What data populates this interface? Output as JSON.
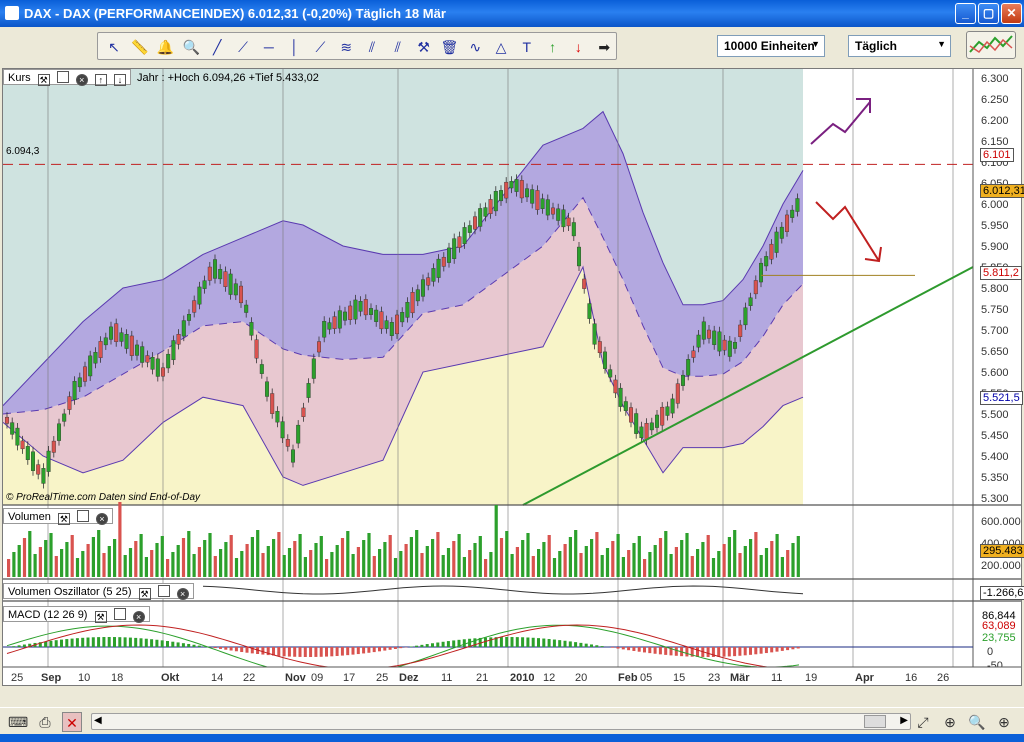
{
  "window": {
    "title": "DAX - DAX (PERFORMANCEINDEX)      6.012,31 (-0,20%)      Täglich   18 Mär"
  },
  "toolbar": {
    "icons": [
      "cursor-icon",
      "ruler-icon",
      "alarm-icon",
      "zoom-icon",
      "line-icon",
      "ray-icon",
      "horizontal-line-icon",
      "vertical-line-icon",
      "fan-icon",
      "fibonacci-icon",
      "channel-icon",
      "parallel-icon",
      "tools-icon",
      "trash-icon",
      "pattern-icon",
      "triangle-icon",
      "text-icon",
      "buy-arrow-icon",
      "sell-arrow-icon",
      "next-arrow-icon"
    ],
    "units_select": "10000 Einheiten",
    "period_select": "Täglich"
  },
  "price_panel": {
    "label": "Kurs",
    "stats": "Jahr : +Hoch 6.094,26 +Tief 5.433,02",
    "high_line_label": "6.094,3",
    "copyright": "© ProRealTime.com  Daten sind End-of-Day",
    "badges": {
      "resistance": "6.101",
      "last": "6.012,31",
      "support": "5.811,2",
      "lower": "5.521,5"
    },
    "axis_ticks": [
      "6.300",
      "6.250",
      "6.200",
      "6.150",
      "6.100",
      "6.050",
      "6.000",
      "5.950",
      "5.900",
      "5.850",
      "5.800",
      "5.750",
      "5.700",
      "5.650",
      "5.600",
      "5.550",
      "5.500",
      "5.450",
      "5.400",
      "5.350",
      "5.300"
    ]
  },
  "volume_panel": {
    "label": "Volumen",
    "axis_ticks": [
      "600.000",
      "400.000",
      "200.000"
    ],
    "badge": "295.483"
  },
  "oscillator_panel": {
    "label": "Volumen Oszillator (5 25)",
    "badge": "-1.266,6"
  },
  "macd_panel": {
    "label": "MACD (12 26 9)",
    "badges": [
      "86,844",
      "63,089",
      "23,755"
    ],
    "axis_ticks": [
      "50",
      "0",
      "-50",
      "-100"
    ]
  },
  "x_axis": {
    "labels": [
      "25",
      "Sep",
      "10",
      "18",
      "Okt",
      "14",
      "22",
      "Nov",
      "09",
      "17",
      "25",
      "Dez",
      "11",
      "21",
      "2010",
      "12",
      "20",
      "Feb",
      "05",
      "15",
      "23",
      "Mär",
      "11",
      "19",
      "Apr",
      "16",
      "26"
    ]
  },
  "colors": {
    "upper_band": "#b3a8e0",
    "lower_band": "#e8c8d0",
    "below_band": "#f8f4c8",
    "bull_candle": "#2ca02c",
    "bear_candle": "#d9534f",
    "trendline": "#2e9a2e",
    "title_bar": "#0a5fd8"
  },
  "statusbar": {
    "icons": [
      "keyboard-icon",
      "print-icon",
      "disconnect-icon",
      "scroll-left-icon",
      "scroll-right-icon",
      "fit-icon",
      "zoom-fit-icon",
      "zoom-out-icon",
      "zoom-in-icon"
    ]
  }
}
